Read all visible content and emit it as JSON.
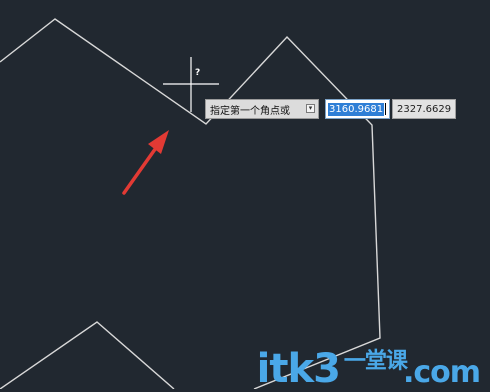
{
  "drawing": {
    "cursor_question_mark": "?"
  },
  "dynamic_input": {
    "prompt": "指定第一个角点或",
    "options_glyph": "▾",
    "x_value": "3160.9681",
    "y_value": "2327.6629"
  },
  "watermark": {
    "text": "itk3",
    "suffix": "一堂课",
    "domain": ".com"
  },
  "colors": {
    "background": "#212830",
    "lines": "#d8d8d8",
    "arrow": "#e23a34",
    "selection": "#2f7fd6",
    "watermark": "#4aa8e8"
  }
}
